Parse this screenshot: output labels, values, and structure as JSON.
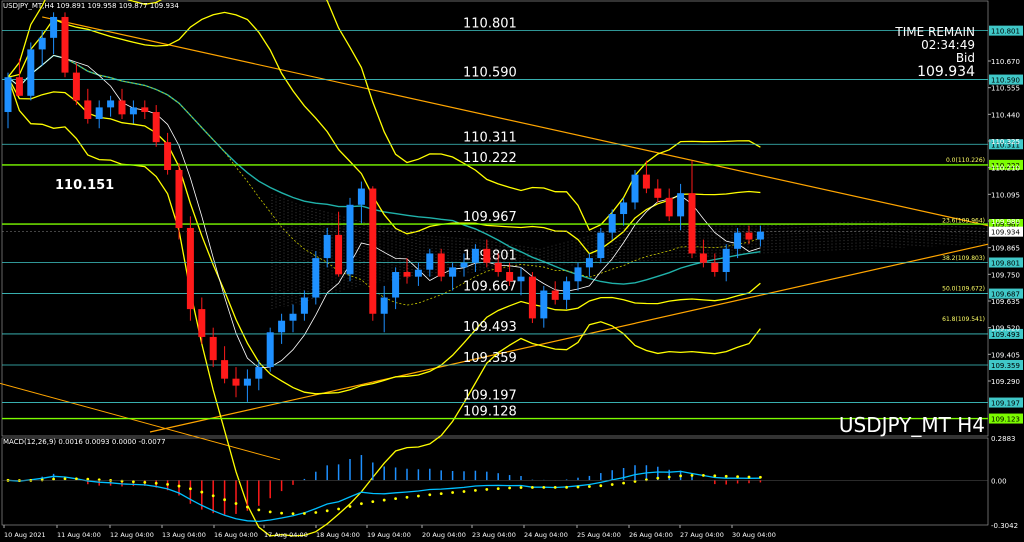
{
  "symbol_header": "USDJPY_MT,H4  109.891 109.958 109.877 109.934",
  "watermark": "USDJPY_MT H4",
  "info_panel": {
    "time_remain_label": "TIME REMAIN",
    "time_remain": "02:34:49",
    "bid_label": "Bid",
    "bid": "109.934"
  },
  "big_price_label": "110.151",
  "macd_header": "MACD(12,26,9) 0.0016 0.0093 0.0000 -0.0077",
  "colors": {
    "bull": "#1e90ff",
    "bear": "#ff1a1a",
    "cyan_level": "#40c8c8",
    "green_level": "#7cfc00",
    "yellow": "#ffff00",
    "orange": "#ffa500",
    "ma": "#20b2aa",
    "signal": "#ffff00",
    "macd_line": "#00bfff"
  },
  "chart_data": {
    "type": "candlestick",
    "symbol": "USDJPY_MT",
    "timeframe": "H4",
    "x_ticks": [
      "10 Aug 2021",
      "11 Aug 04:00",
      "12 Aug 04:00",
      "13 Aug 04:00",
      "16 Aug 04:00",
      "17 Aug 04:00",
      "18 Aug 04:00",
      "19 Aug 04:00",
      "20 Aug 04:00",
      "23 Aug 04:00",
      "24 Aug 04:00",
      "25 Aug 04:00",
      "26 Aug 04:00",
      "27 Aug 04:00",
      "30 Aug 04:00"
    ],
    "y_range": [
      109.07,
      110.89
    ],
    "y_ticks": [
      "110.670",
      "110.555",
      "110.440",
      "110.325",
      "110.210",
      "110.095",
      "109.980",
      "109.865",
      "109.750",
      "109.635",
      "109.520",
      "109.405",
      "109.290"
    ],
    "level_lines": [
      {
        "label": "110.801",
        "value": 110.801,
        "tag": "110.801",
        "color": "cyan"
      },
      {
        "label": "110.590",
        "value": 110.59,
        "tag": "110.590",
        "color": "cyan"
      },
      {
        "label": "110.311",
        "value": 110.311,
        "tag": "110.311",
        "color": "cyan"
      },
      {
        "label": "110.222",
        "value": 110.222,
        "tag": "110.222",
        "color": "green"
      },
      {
        "label": "109.967",
        "value": 109.967,
        "tag": "109.967",
        "color": "green"
      },
      {
        "label": "109.801",
        "value": 109.801,
        "tag": "109.801",
        "color": "cyan"
      },
      {
        "label": "109.667",
        "value": 109.667,
        "tag": "109.687",
        "color": "cyan"
      },
      {
        "label": "109.493",
        "value": 109.493,
        "tag": "109.493",
        "color": "cyan"
      },
      {
        "label": "109.359",
        "value": 109.359,
        "tag": "109.359",
        "color": "cyan"
      },
      {
        "label": "109.197",
        "value": 109.197,
        "tag": "109.197",
        "color": "cyan"
      },
      {
        "label": "109.128",
        "value": 109.128,
        "tag": "109.123",
        "color": "green"
      }
    ],
    "fib_labels": [
      {
        "label": "0.0(110.226)",
        "value": 110.226
      },
      {
        "label": "23.6(109.964)",
        "value": 109.964
      },
      {
        "label": "38.2(109.803)",
        "value": 109.803
      },
      {
        "label": "50.0(109.672)",
        "value": 109.672
      },
      {
        "label": "61.8(109.541)",
        "value": 109.541
      }
    ],
    "current_price": 109.934,
    "ohlc": [
      [
        110.45,
        110.62,
        110.38,
        110.6
      ],
      [
        110.6,
        110.68,
        110.52,
        110.52
      ],
      [
        110.52,
        110.75,
        110.5,
        110.72
      ],
      [
        110.72,
        110.8,
        110.65,
        110.77
      ],
      [
        110.77,
        110.88,
        110.7,
        110.86
      ],
      [
        110.86,
        110.88,
        110.6,
        110.62
      ],
      [
        110.62,
        110.66,
        110.48,
        110.5
      ],
      [
        110.5,
        110.55,
        110.4,
        110.42
      ],
      [
        110.42,
        110.5,
        110.38,
        110.47
      ],
      [
        110.47,
        110.52,
        110.43,
        110.5
      ],
      [
        110.5,
        110.55,
        110.42,
        110.44
      ],
      [
        110.44,
        110.5,
        110.4,
        110.47
      ],
      [
        110.47,
        110.5,
        110.42,
        110.45
      ],
      [
        110.45,
        110.48,
        110.3,
        110.32
      ],
      [
        110.32,
        110.36,
        110.18,
        110.2
      ],
      [
        110.2,
        110.23,
        109.9,
        109.95
      ],
      [
        109.95,
        110.0,
        109.55,
        109.6
      ],
      [
        109.6,
        109.65,
        109.45,
        109.48
      ],
      [
        109.48,
        109.52,
        109.35,
        109.38
      ],
      [
        109.38,
        109.44,
        109.28,
        109.3
      ],
      [
        109.3,
        109.35,
        109.22,
        109.27
      ],
      [
        109.27,
        109.34,
        109.2,
        109.3
      ],
      [
        109.3,
        109.38,
        109.25,
        109.35
      ],
      [
        109.35,
        109.52,
        109.33,
        109.5
      ],
      [
        109.5,
        109.58,
        109.45,
        109.55
      ],
      [
        109.55,
        109.62,
        109.5,
        109.58
      ],
      [
        109.58,
        109.68,
        109.55,
        109.65
      ],
      [
        109.65,
        109.85,
        109.62,
        109.82
      ],
      [
        109.82,
        109.95,
        109.78,
        109.92
      ],
      [
        109.92,
        110.02,
        109.74,
        109.75
      ],
      [
        109.75,
        110.08,
        109.72,
        110.05
      ],
      [
        110.05,
        110.15,
        109.97,
        110.12
      ],
      [
        110.12,
        110.13,
        109.55,
        109.58
      ],
      [
        109.58,
        109.7,
        109.5,
        109.65
      ],
      [
        109.65,
        109.78,
        109.6,
        109.76
      ],
      [
        109.76,
        109.82,
        109.71,
        109.74
      ],
      [
        109.74,
        109.8,
        109.7,
        109.77
      ],
      [
        109.77,
        109.86,
        109.74,
        109.84
      ],
      [
        109.84,
        109.86,
        109.72,
        109.74
      ],
      [
        109.74,
        109.8,
        109.68,
        109.78
      ],
      [
        109.78,
        109.84,
        109.74,
        109.8
      ],
      [
        109.8,
        109.88,
        109.76,
        109.86
      ],
      [
        109.86,
        109.9,
        109.78,
        109.8
      ],
      [
        109.8,
        109.84,
        109.74,
        109.76
      ],
      [
        109.76,
        109.8,
        109.7,
        109.72
      ],
      [
        109.72,
        109.78,
        109.66,
        109.74
      ],
      [
        109.74,
        109.76,
        109.54,
        109.56
      ],
      [
        109.56,
        109.7,
        109.52,
        109.68
      ],
      [
        109.68,
        109.72,
        109.62,
        109.64
      ],
      [
        109.64,
        109.74,
        109.6,
        109.72
      ],
      [
        109.72,
        109.8,
        109.68,
        109.78
      ],
      [
        109.78,
        109.84,
        109.74,
        109.82
      ],
      [
        109.82,
        109.95,
        109.8,
        109.93
      ],
      [
        109.93,
        110.03,
        109.9,
        110.01
      ],
      [
        110.01,
        110.08,
        109.96,
        110.06
      ],
      [
        110.06,
        110.2,
        110.03,
        110.18
      ],
      [
        110.18,
        110.24,
        110.1,
        110.12
      ],
      [
        110.12,
        110.16,
        110.06,
        110.08
      ],
      [
        110.08,
        110.12,
        109.98,
        110.0
      ],
      [
        110.0,
        110.14,
        109.94,
        110.1
      ],
      [
        110.1,
        110.24,
        109.82,
        109.84
      ],
      [
        109.84,
        109.9,
        109.78,
        109.8
      ],
      [
        109.8,
        109.84,
        109.74,
        109.76
      ],
      [
        109.76,
        109.88,
        109.72,
        109.86
      ],
      [
        109.86,
        109.95,
        109.82,
        109.93
      ],
      [
        109.93,
        109.96,
        109.88,
        109.9
      ],
      [
        109.9,
        109.96,
        109.87,
        109.934
      ]
    ],
    "macd": {
      "range": [
        -0.3042,
        0.2883
      ],
      "ticks": [
        "0.2883",
        "0.00",
        "-0.3042"
      ]
    }
  }
}
